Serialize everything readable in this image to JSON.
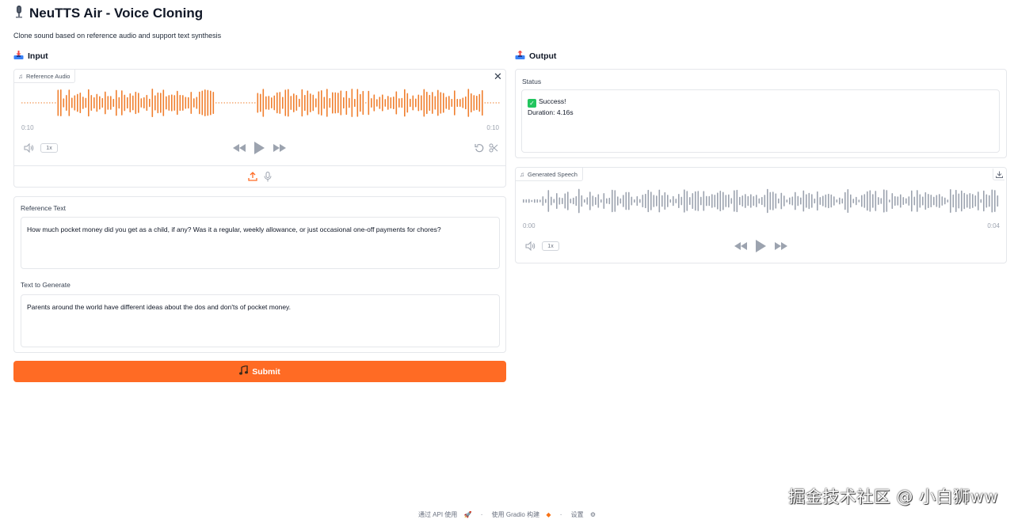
{
  "header": {
    "icon": "microphone-icon",
    "title": "NeuTTS Air - Voice Cloning",
    "description": "Clone sound based on reference audio and support text synthesis"
  },
  "input_section": {
    "icon": "inbox-tray-icon",
    "title": "Input",
    "reference_audio": {
      "label": "Reference Audio",
      "current_time": "0:10",
      "duration": "0:10",
      "playback_rate": "1x",
      "progress": 1.0
    },
    "reference_text": {
      "label": "Reference Text",
      "value": "How much pocket money did you get as a child, if any? Was it a regular, weekly allowance, or just occasional one-off payments for chores?"
    },
    "text_to_generate": {
      "label": "Text to Generate",
      "value": "Parents around the world have different ideas about the dos and don'ts of pocket money."
    },
    "submit": {
      "icon": "music-note-icon",
      "label": "Submit"
    }
  },
  "output_section": {
    "icon": "outbox-tray-icon",
    "title": "Output",
    "status": {
      "label": "Status",
      "line1": "Success!",
      "line2": "Duration: 4.16s"
    },
    "generated_speech": {
      "label": "Generated Speech",
      "current_time": "0:00",
      "duration": "0:04",
      "playback_rate": "1x",
      "progress": 0.0
    }
  },
  "footer": {
    "api": "通过 API 使用",
    "gradio": "使用 Gradio 构建",
    "settings": "设置"
  },
  "watermark": "掘金技术社区 @ 小白狮ww",
  "colors": {
    "accent": "#ff6b24",
    "waveform_active": "#f07f2e",
    "waveform_idle": "#9ca3af"
  }
}
